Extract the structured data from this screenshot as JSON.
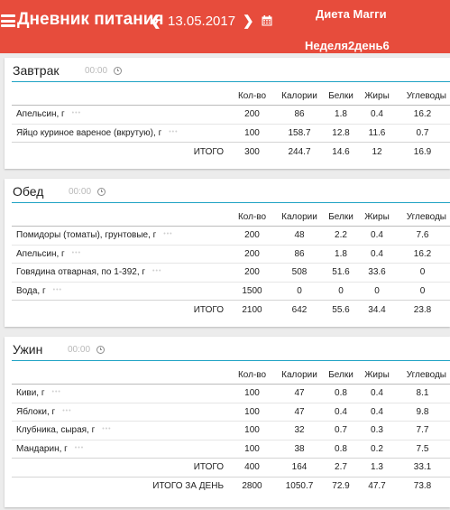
{
  "header": {
    "title": "Дневник питания",
    "date": "13.05.2017",
    "diet_name": "Диета Магги",
    "week_day": "Неделя2день6"
  },
  "columns": [
    "Кол-во",
    "Калории",
    "Белки",
    "Жиры",
    "Углеводы"
  ],
  "more_glyph": "•••",
  "total_label": "ИТОГО",
  "meals": [
    {
      "name": "Завтрак",
      "time": "00:00",
      "items": [
        {
          "name": "Апельсин, г",
          "qty": "200",
          "cal": "86",
          "protein": "1.8",
          "fat": "0.4",
          "carbs": "16.2"
        },
        {
          "name": "Яйцо куриное вареное (вкрутую), г",
          "qty": "100",
          "cal": "158.7",
          "protein": "12.8",
          "fat": "11.6",
          "carbs": "0.7"
        }
      ],
      "total": {
        "qty": "300",
        "cal": "244.7",
        "protein": "14.6",
        "fat": "12",
        "carbs": "16.9"
      }
    },
    {
      "name": "Обед",
      "time": "00:00",
      "items": [
        {
          "name": "Помидоры (томаты), грунтовые, г",
          "qty": "200",
          "cal": "48",
          "protein": "2.2",
          "fat": "0.4",
          "carbs": "7.6"
        },
        {
          "name": "Апельсин, г",
          "qty": "200",
          "cal": "86",
          "protein": "1.8",
          "fat": "0.4",
          "carbs": "16.2"
        },
        {
          "name": "Говядина отварная, по 1-392, г",
          "qty": "200",
          "cal": "508",
          "protein": "51.6",
          "fat": "33.6",
          "carbs": "0"
        },
        {
          "name": "Вода, г",
          "qty": "1500",
          "cal": "0",
          "protein": "0",
          "fat": "0",
          "carbs": "0"
        }
      ],
      "total": {
        "qty": "2100",
        "cal": "642",
        "protein": "55.6",
        "fat": "34.4",
        "carbs": "23.8"
      }
    },
    {
      "name": "Ужин",
      "time": "00:00",
      "items": [
        {
          "name": "Киви, г",
          "qty": "100",
          "cal": "47",
          "protein": "0.8",
          "fat": "0.4",
          "carbs": "8.1"
        },
        {
          "name": "Яблоки, г",
          "qty": "100",
          "cal": "47",
          "protein": "0.4",
          "fat": "0.4",
          "carbs": "9.8"
        },
        {
          "name": "Клубника, сырая, г",
          "qty": "100",
          "cal": "32",
          "protein": "0.7",
          "fat": "0.3",
          "carbs": "7.7"
        },
        {
          "name": "Мандарин, г",
          "qty": "100",
          "cal": "38",
          "protein": "0.8",
          "fat": "0.2",
          "carbs": "7.5"
        }
      ],
      "total": {
        "qty": "400",
        "cal": "164",
        "protein": "2.7",
        "fat": "1.3",
        "carbs": "33.1"
      }
    }
  ],
  "day_total": {
    "label": "ИТОГО ЗА ДЕНЬ",
    "qty": "2800",
    "cal": "1050.7",
    "protein": "72.9",
    "fat": "47.7",
    "carbs": "73.8"
  }
}
